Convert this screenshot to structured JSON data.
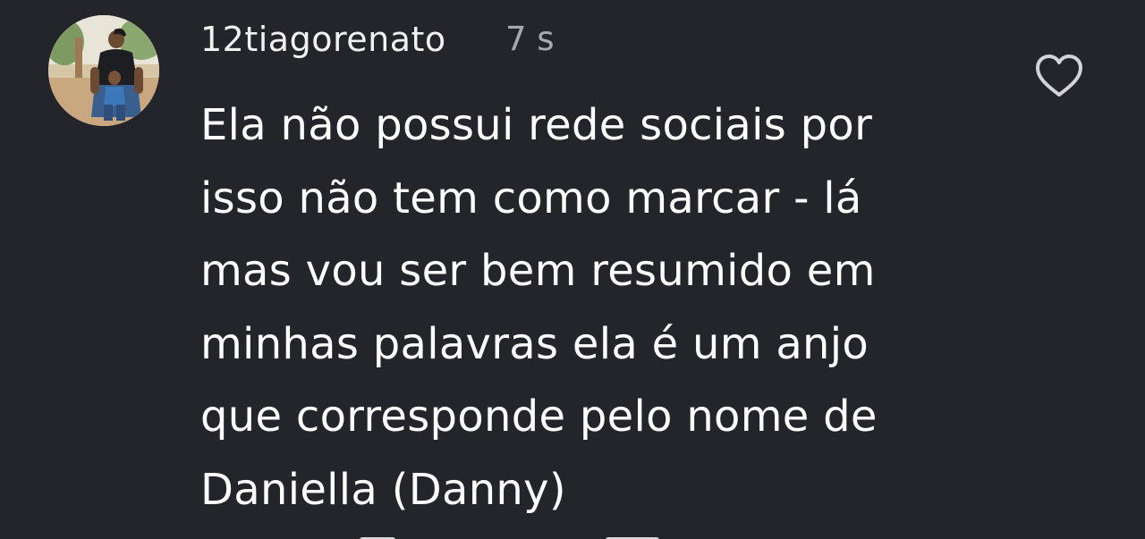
{
  "comment": {
    "username": "12tiagorenato",
    "timestamp": "7 s",
    "text": "Ela não possui rede sociais por\nisso não tem como marcar - lá\nmas vou ser bem resumido em\nminhas palavras ela é um anjo\nque corresponde pelo nome de\nDaniella (Danny)",
    "like_icon": "heart-outline-icon",
    "avatar": "profile-photo"
  },
  "colors": {
    "background": "#24252b",
    "text": "#ffffff",
    "muted": "#a9a9ad"
  }
}
